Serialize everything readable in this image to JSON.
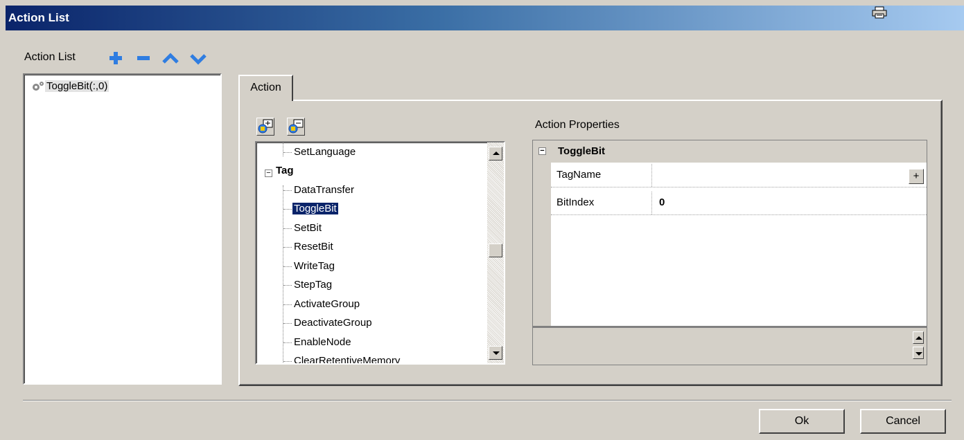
{
  "window": {
    "title": "Action List",
    "title_icon": "printer-icon"
  },
  "action_list": {
    "label": "Action List",
    "toolbar": {
      "add": "add-icon",
      "remove": "remove-icon",
      "up": "move-up-icon",
      "down": "move-down-icon",
      "accent": "#2f7de1"
    },
    "items": [
      {
        "label": "ToggleBit(:,0)",
        "icon": "gear-icon"
      }
    ]
  },
  "tabs": [
    {
      "label": "Action",
      "active": true
    }
  ],
  "action_tree": {
    "rows": [
      {
        "label": "SetLanguage",
        "level": 1
      },
      {
        "label": "Tag",
        "level": 0,
        "expanded": true,
        "bold": true
      },
      {
        "label": "DataTransfer",
        "level": 1
      },
      {
        "label": "ToggleBit",
        "level": 1,
        "selected": true
      },
      {
        "label": "SetBit",
        "level": 1
      },
      {
        "label": "ResetBit",
        "level": 1
      },
      {
        "label": "WriteTag",
        "level": 1
      },
      {
        "label": "StepTag",
        "level": 1
      },
      {
        "label": "ActivateGroup",
        "level": 1
      },
      {
        "label": "DeactivateGroup",
        "level": 1
      },
      {
        "label": "EnableNode",
        "level": 1
      },
      {
        "label": "ClearRetentiveMemory",
        "level": 1
      }
    ]
  },
  "properties": {
    "label": "Action Properties",
    "category": "ToggleBit",
    "rows": [
      {
        "name": "TagName",
        "value": "",
        "button": "+"
      },
      {
        "name": "BitIndex",
        "value": "0"
      }
    ]
  },
  "footer": {
    "ok": "Ok",
    "cancel": "Cancel"
  }
}
